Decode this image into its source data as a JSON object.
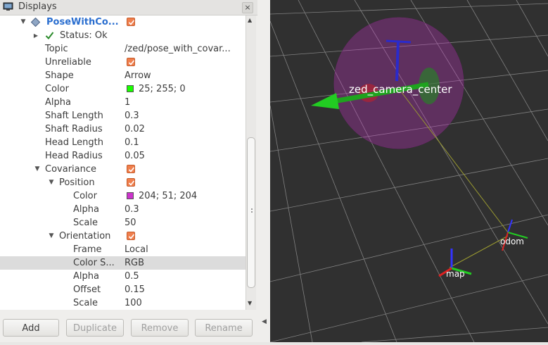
{
  "panel": {
    "title": "Displays",
    "close_glyph": "×"
  },
  "tree": [
    {
      "name": "PoseWithCo...",
      "value": "",
      "type": "display",
      "checked": true
    },
    {
      "name": "Status: Ok",
      "value": "",
      "type": "status"
    },
    {
      "name": "Topic",
      "value": "/zed/pose_with_covar..."
    },
    {
      "name": "Unreliable",
      "value": "",
      "checked": true
    },
    {
      "name": "Shape",
      "value": "Arrow"
    },
    {
      "name": "Color",
      "value": "25; 255; 0",
      "swatch": "#19ff00"
    },
    {
      "name": "Alpha",
      "value": "1"
    },
    {
      "name": "Shaft Length",
      "value": "0.3"
    },
    {
      "name": "Shaft Radius",
      "value": "0.02"
    },
    {
      "name": "Head Length",
      "value": "0.1"
    },
    {
      "name": "Head Radius",
      "value": "0.05"
    },
    {
      "name": "Covariance",
      "value": "",
      "checked": true,
      "expanded": true
    },
    {
      "name": "Position",
      "value": "",
      "checked": true,
      "expanded": true
    },
    {
      "name": "Color",
      "value": "204; 51; 204",
      "swatch": "#cc33cc"
    },
    {
      "name": "Alpha",
      "value": "0.3"
    },
    {
      "name": "Scale",
      "value": "50"
    },
    {
      "name": "Orientation",
      "value": "",
      "checked": true,
      "expanded": true
    },
    {
      "name": "Frame",
      "value": "Local"
    },
    {
      "name": "Color S...",
      "value": "RGB",
      "selected": true
    },
    {
      "name": "Alpha",
      "value": "0.5"
    },
    {
      "name": "Offset",
      "value": "0.15"
    },
    {
      "name": "Scale",
      "value": "100"
    }
  ],
  "buttons": {
    "add": "Add",
    "duplicate": "Duplicate",
    "remove": "Remove",
    "rename": "Rename"
  },
  "viewport": {
    "background": "#303030",
    "grid_color": "#8a8a8a",
    "frame_labels": [
      "zed_camera_center",
      "odom",
      "map"
    ]
  }
}
